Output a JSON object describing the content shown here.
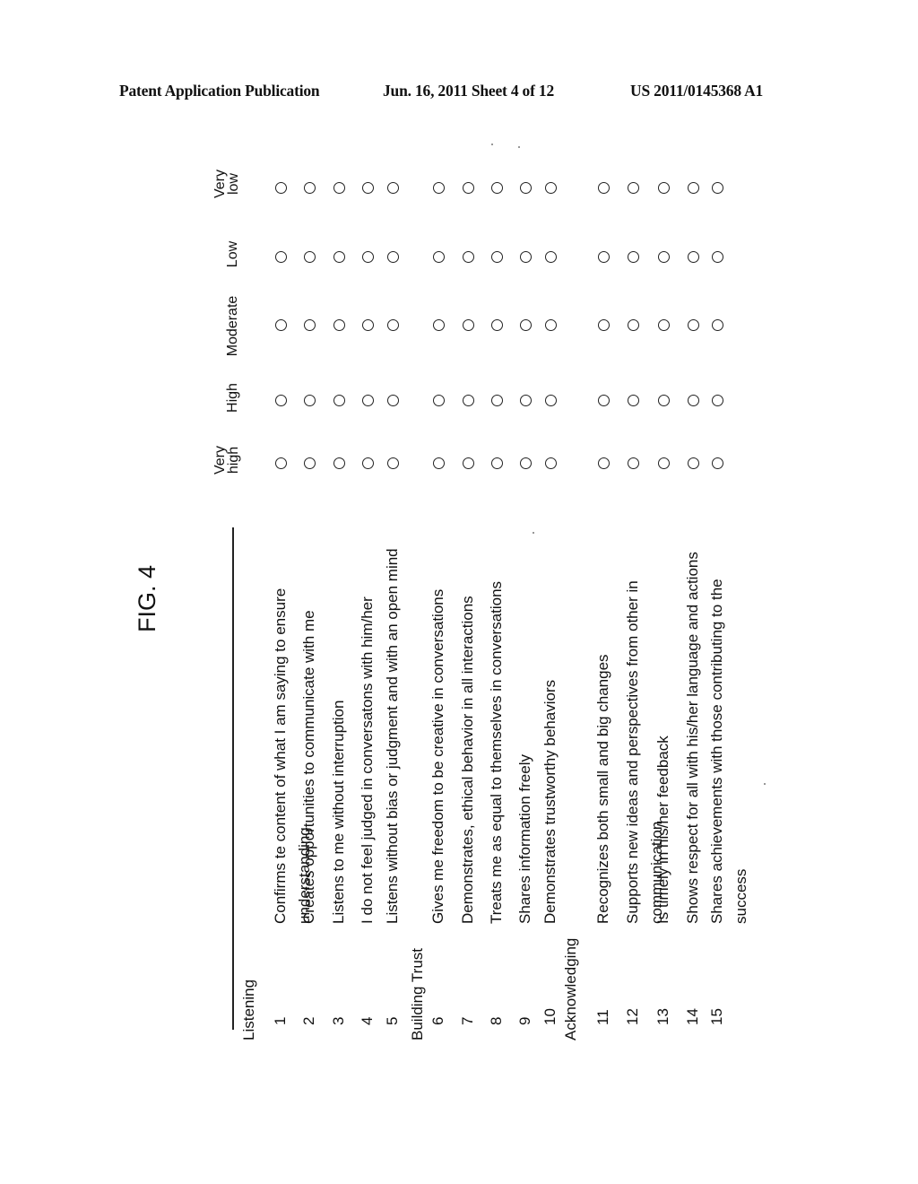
{
  "header": {
    "left": "Patent Application Publication",
    "middle": "Jun. 16, 2011  Sheet 4 of 12",
    "right": "US 2011/0145368 A1"
  },
  "figure": {
    "title": "FIG. 4",
    "rating_columns": [
      {
        "line1": "Very",
        "line2": "high"
      },
      {
        "line1": "High",
        "line2": ""
      },
      {
        "line1": "Moderate",
        "line2": ""
      },
      {
        "line1": "Low",
        "line2": ""
      },
      {
        "line1": "Very",
        "line2": "low"
      }
    ],
    "sections": [
      {
        "title": "Listening",
        "items": [
          {
            "num": "1",
            "line1": "Confirms te content of what I am saying to ensure",
            "line2": "understanding"
          },
          {
            "num": "2",
            "line1": "Creates opportunities to communicate with me",
            "line2": ""
          },
          {
            "num": "3",
            "line1": "Listens to me without interruption",
            "line2": ""
          },
          {
            "num": "4",
            "line1": "I do not feel judged in conversatons with him/her",
            "line2": ""
          },
          {
            "num": "5",
            "line1": "Listens without bias or judgment and with an open mind",
            "line2": ""
          }
        ]
      },
      {
        "title": "Building Trust",
        "items": [
          {
            "num": "6",
            "line1": "Gives me freedom to be creative in conversations",
            "line2": ""
          },
          {
            "num": "7",
            "line1": "Demonstrates, ethical behavior in all interactions",
            "line2": ""
          },
          {
            "num": "8",
            "line1": "Treats me as equal to themselves in conversations",
            "line2": ""
          },
          {
            "num": "9",
            "line1": "Shares information freely",
            "line2": ""
          },
          {
            "num": "10",
            "line1": "Demonstrates trustworthy behaviors",
            "line2": ""
          }
        ]
      },
      {
        "title": "Acknowledging",
        "items": [
          {
            "num": "11",
            "line1": "Recognizes both small and big changes",
            "line2": ""
          },
          {
            "num": "12",
            "line1": "Supports new ideas and perspectives from other in",
            "line2": "communication"
          },
          {
            "num": "13",
            "line1": "Is timely in his/her feedback",
            "line2": ""
          },
          {
            "num": "14",
            "line1": "Shows respect for all with his/her language and actions",
            "line2": ""
          },
          {
            "num": "15",
            "line1": "Shares achievements with those contributing to the",
            "line2": "success"
          }
        ]
      }
    ],
    "selected_ratings": []
  }
}
